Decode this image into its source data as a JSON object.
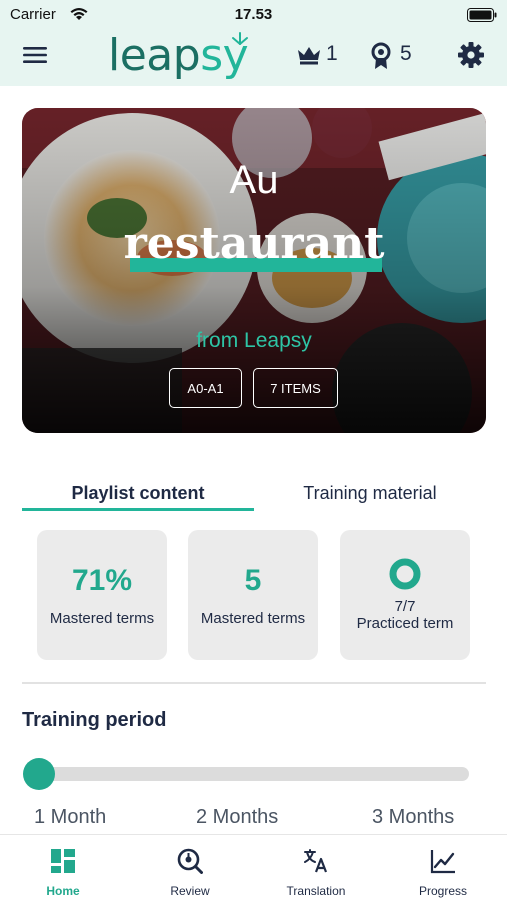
{
  "status_bar": {
    "carrier": "Carrier",
    "time": "17.53"
  },
  "header": {
    "logo_part1": "leap",
    "logo_part2": "sy",
    "crowns": "1",
    "medals": "5",
    "icons": [
      "menu-icon",
      "crown-icon",
      "medal-icon",
      "gear-icon"
    ]
  },
  "hero": {
    "pretitle": "Au",
    "title": "restaurant",
    "subtitle": "from Leapsy",
    "tags": [
      "A0-A1",
      "7 ITEMS"
    ]
  },
  "tabs": [
    {
      "label": "Playlist content",
      "active": true
    },
    {
      "label": "Training material",
      "active": false
    }
  ],
  "stats": [
    {
      "value": "71%",
      "label": "Mastered terms"
    },
    {
      "value": "5",
      "label": "Mastered terms"
    },
    {
      "ratio": "7/7",
      "label": "Practiced term",
      "icon": "ring-icon"
    }
  ],
  "training_period": {
    "title": "Training period",
    "options": [
      "1 Month",
      "2 Months",
      "3 Months"
    ],
    "selected_index": 0
  },
  "bottom_nav": [
    {
      "label": "Home",
      "icon": "home-grid-icon",
      "active": true
    },
    {
      "label": "Review",
      "icon": "review-icon",
      "active": false
    },
    {
      "label": "Translation",
      "icon": "translation-icon",
      "active": false
    },
    {
      "label": "Progress",
      "icon": "progress-chart-icon",
      "active": false
    }
  ],
  "colors": {
    "accent": "#22a88d",
    "header_bg": "#e7f5f1",
    "navy": "#1f2a44",
    "card_bg": "#ebebeb"
  }
}
